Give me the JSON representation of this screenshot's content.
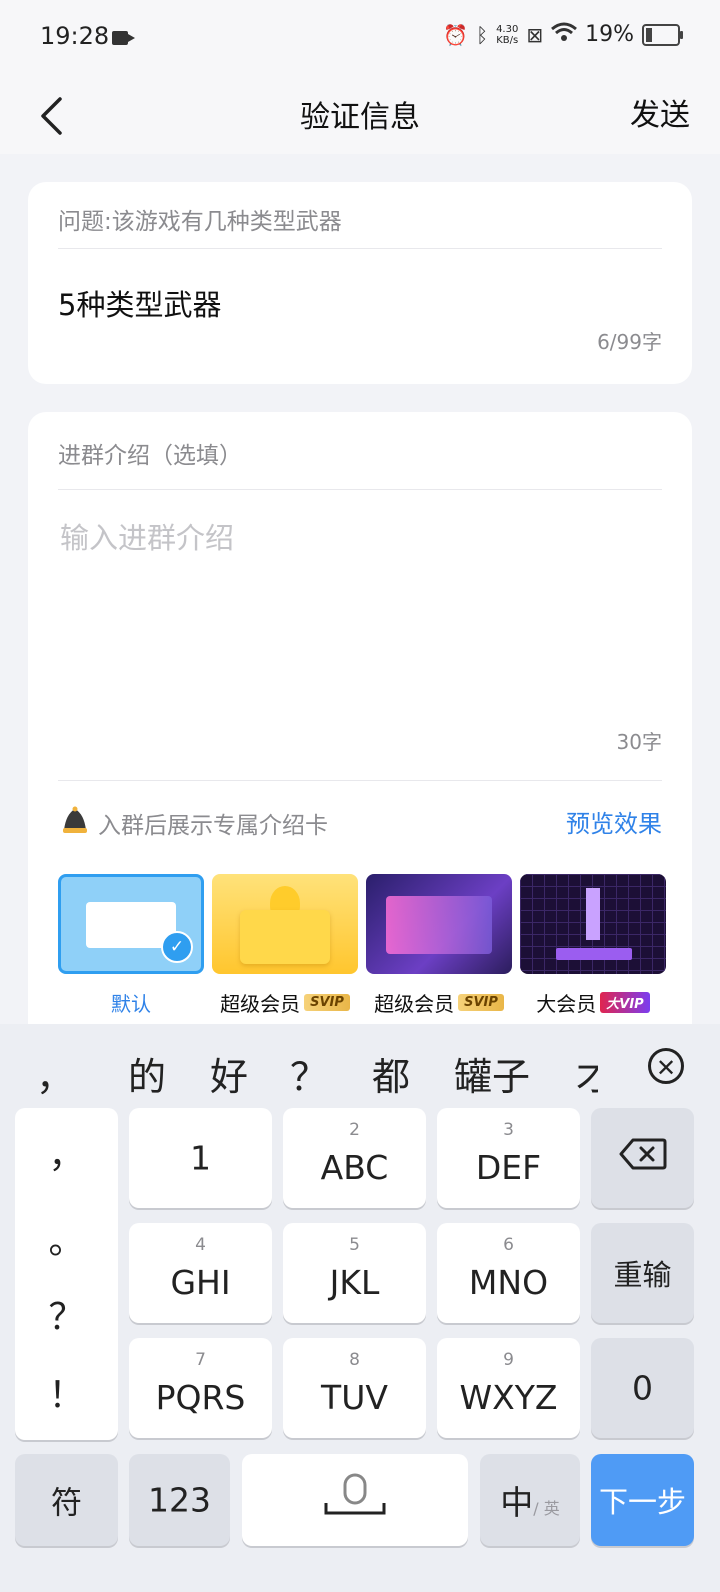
{
  "status": {
    "time": "19:28",
    "speed_top": "4.30",
    "speed_unit": "KB/s",
    "battery": "19%"
  },
  "nav": {
    "title": "验证信息",
    "send_label": "发送"
  },
  "question": {
    "label": "问题:该游戏有几种类型武器",
    "answer": "5种类型武器",
    "counter": "6/99字"
  },
  "intro": {
    "label": "进群介绍（选填）",
    "placeholder": "输入进群介绍",
    "counter": "30字"
  },
  "cards_section": {
    "label": "入群后展示专属介绍卡",
    "preview_label": "预览效果",
    "templates": [
      {
        "caption": "默认",
        "badge": "",
        "selected": true
      },
      {
        "caption": "超级会员",
        "badge": "SVIP"
      },
      {
        "caption": "超级会员",
        "badge": "SVIP"
      },
      {
        "caption": "大会员",
        "badge": "大VIP"
      }
    ]
  },
  "keyboard": {
    "candidates": [
      "，",
      "的",
      "好",
      "？",
      "都",
      "罐子",
      "才"
    ],
    "left_punct": [
      "，",
      "。",
      "？",
      "！"
    ],
    "keys": [
      {
        "num": "",
        "label": "1"
      },
      {
        "num": "2",
        "label": "ABC"
      },
      {
        "num": "3",
        "label": "DEF"
      },
      {
        "num": "4",
        "label": "GHI"
      },
      {
        "num": "5",
        "label": "JKL"
      },
      {
        "num": "6",
        "label": "MNO"
      },
      {
        "num": "7",
        "label": "PQRS"
      },
      {
        "num": "8",
        "label": "TUV"
      },
      {
        "num": "9",
        "label": "WXYZ"
      }
    ],
    "reenter": "重输",
    "zero": "0",
    "symbols": "符",
    "numbers": "123",
    "lang_main": "中",
    "lang_sub": "/ 英",
    "next": "下一步"
  }
}
